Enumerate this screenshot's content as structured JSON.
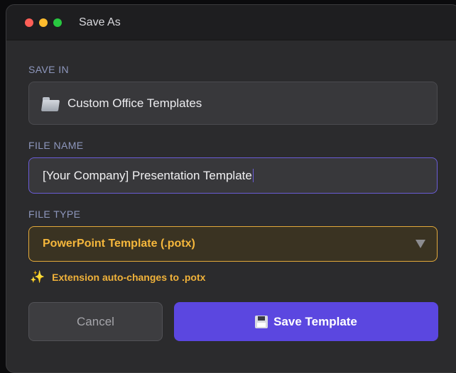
{
  "window": {
    "title": "Save As"
  },
  "save_in": {
    "label": "SAVE IN",
    "folder": "Custom Office Templates",
    "icon": "folder-icon"
  },
  "file_name": {
    "label": "FILE NAME",
    "value": "[Your Company] Presentation Template"
  },
  "file_type": {
    "label": "FILE TYPE",
    "selected": "PowerPoint Template (.potx)",
    "icon": "dropdown-triangle-icon"
  },
  "hint": {
    "icon": "sparkle-icon",
    "text": "Extension auto-changes to .potx"
  },
  "buttons": {
    "cancel": "Cancel",
    "save": "Save Template",
    "save_icon": "floppy-disk-icon"
  },
  "colors": {
    "accent": "#5b47e0",
    "focus_border": "#6a5cd6",
    "warning": "#f0b23a",
    "close": "#ff5f57",
    "minimize": "#febc2e",
    "maximize": "#28c840"
  }
}
